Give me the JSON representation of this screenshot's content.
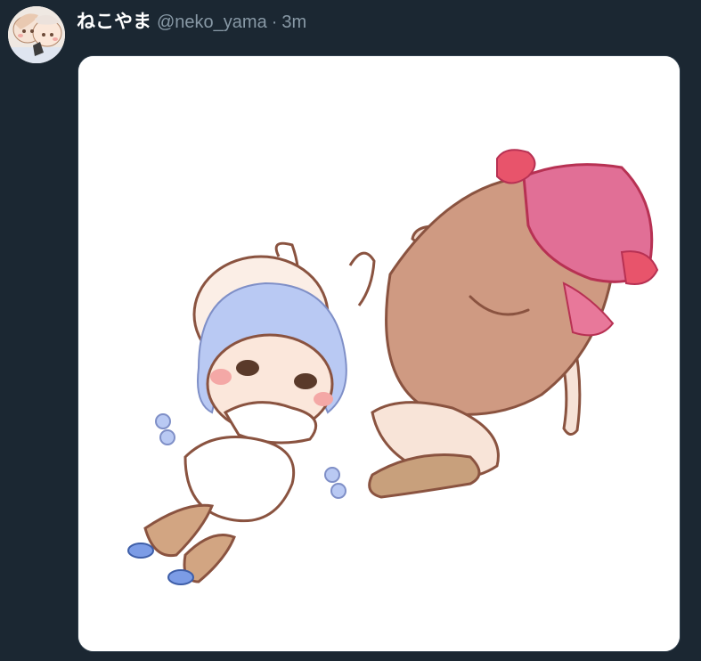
{
  "tweet": {
    "display_name": "ねこやま",
    "handle": "@neko_yama",
    "separator": "·",
    "time": "3m"
  },
  "media": {
    "type": "image",
    "background": "#ffffff"
  },
  "colors": {
    "background": "#1b2732",
    "name": "#ffffff",
    "meta": "#8899a6"
  }
}
